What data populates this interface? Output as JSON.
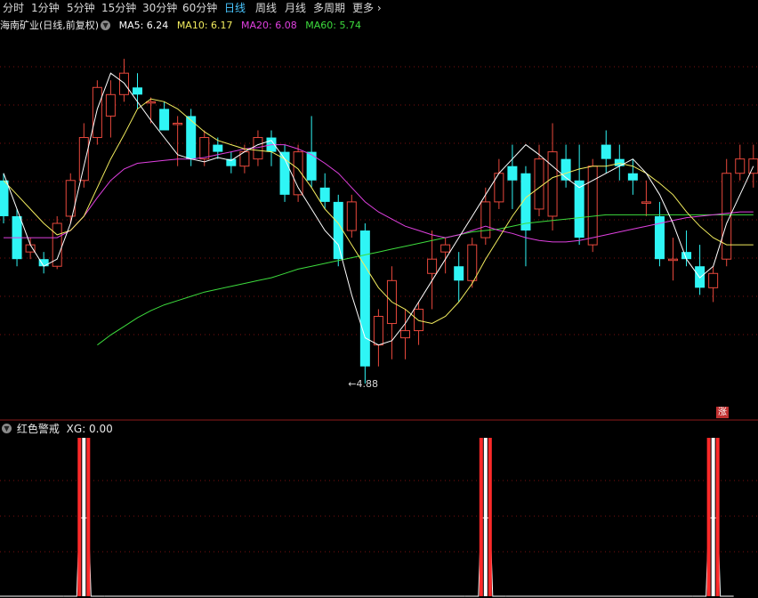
{
  "tabs": [
    {
      "label": "分时",
      "active": false
    },
    {
      "label": "1分钟",
      "active": false
    },
    {
      "label": "5分钟",
      "active": false
    },
    {
      "label": "15分钟",
      "active": false
    },
    {
      "label": "30分钟",
      "active": false
    },
    {
      "label": "60分钟",
      "active": false
    },
    {
      "label": "日线",
      "active": true
    },
    {
      "label": "周线",
      "active": false
    },
    {
      "label": "月线",
      "active": false
    },
    {
      "label": "多周期",
      "active": false
    },
    {
      "label": "更多",
      "active": false
    }
  ],
  "main_legend": {
    "title": "海南矿业(日线,前复权)",
    "ma5": "MA5: 6.24",
    "ma10": "MA10: 6.17",
    "ma20": "MA20: 6.08",
    "ma60": "MA60: 5.74"
  },
  "indicator_legend": {
    "name": "红色警戒",
    "value": "XG: 0.00"
  },
  "rise_badge": "涨",
  "colors": {
    "up": "#e8483c",
    "down": "#2ff5f5",
    "ma5": "#ffffff",
    "ma10": "#f2ec5e",
    "ma20": "#e040e0",
    "ma60": "#3ddc3d",
    "grid": "#7a1010",
    "active_tab": "#49c6ff"
  },
  "chart_data": {
    "type": "candlestick",
    "title": "海南矿业(日线,前复权)",
    "y_range": [
      4.7,
      7.3
    ],
    "annotation": {
      "label": "4.88",
      "candle_index": 26
    },
    "candles": [
      [
        6.3,
        6.35,
        6.0,
        6.05
      ],
      [
        6.05,
        6.1,
        5.7,
        5.75
      ],
      [
        5.8,
        5.9,
        5.75,
        5.85
      ],
      [
        5.75,
        5.8,
        5.65,
        5.7
      ],
      [
        5.7,
        6.05,
        5.68,
        6.0
      ],
      [
        6.05,
        6.35,
        6.0,
        6.3
      ],
      [
        6.3,
        6.7,
        6.25,
        6.6
      ],
      [
        6.6,
        7.0,
        6.55,
        6.95
      ],
      [
        6.75,
        7.0,
        6.6,
        6.9
      ],
      [
        6.9,
        7.15,
        6.85,
        7.05
      ],
      [
        6.95,
        7.05,
        6.8,
        6.9
      ],
      [
        6.85,
        6.88,
        6.7,
        6.85
      ],
      [
        6.8,
        6.85,
        6.7,
        6.65
      ],
      [
        6.7,
        6.75,
        6.4,
        6.7
      ],
      [
        6.75,
        6.8,
        6.4,
        6.45
      ],
      [
        6.45,
        6.65,
        6.4,
        6.6
      ],
      [
        6.55,
        6.6,
        6.45,
        6.5
      ],
      [
        6.45,
        6.5,
        6.35,
        6.4
      ],
      [
        6.4,
        6.55,
        6.35,
        6.5
      ],
      [
        6.45,
        6.65,
        6.4,
        6.6
      ],
      [
        6.6,
        6.65,
        6.4,
        6.5
      ],
      [
        6.5,
        6.55,
        6.15,
        6.2
      ],
      [
        6.2,
        6.55,
        6.15,
        6.5
      ],
      [
        6.5,
        6.75,
        6.25,
        6.3
      ],
      [
        6.25,
        6.35,
        6.1,
        6.15
      ],
      [
        6.15,
        6.2,
        5.7,
        5.75
      ],
      [
        5.95,
        6.2,
        5.9,
        6.15
      ],
      [
        5.95,
        6.0,
        4.88,
        5.0
      ],
      [
        5.15,
        5.4,
        5.0,
        5.35
      ],
      [
        5.3,
        5.7,
        5.05,
        5.6
      ],
      [
        5.2,
        5.4,
        5.05,
        5.25
      ],
      [
        5.25,
        5.45,
        5.15,
        5.4
      ],
      [
        5.65,
        5.95,
        5.4,
        5.75
      ],
      [
        5.8,
        5.9,
        5.65,
        5.85
      ],
      [
        5.7,
        5.8,
        5.45,
        5.6
      ],
      [
        5.6,
        5.9,
        5.55,
        5.85
      ],
      [
        5.9,
        6.25,
        5.85,
        6.15
      ],
      [
        6.15,
        6.45,
        6.1,
        6.35
      ],
      [
        6.4,
        6.55,
        6.1,
        6.3
      ],
      [
        6.35,
        6.4,
        5.7,
        5.95
      ],
      [
        6.1,
        6.55,
        6.05,
        6.45
      ],
      [
        6.05,
        6.7,
        5.95,
        6.5
      ],
      [
        6.45,
        6.55,
        6.25,
        6.3
      ],
      [
        6.3,
        6.55,
        5.85,
        5.9
      ],
      [
        5.85,
        6.45,
        5.8,
        6.4
      ],
      [
        6.55,
        6.65,
        6.35,
        6.45
      ],
      [
        6.45,
        6.55,
        6.3,
        6.4
      ],
      [
        6.35,
        6.45,
        6.2,
        6.3
      ],
      [
        6.15,
        6.3,
        6.05,
        6.15
      ],
      [
        6.05,
        6.15,
        5.7,
        5.75
      ],
      [
        5.75,
        5.9,
        5.6,
        5.75
      ],
      [
        5.8,
        5.95,
        5.7,
        5.75
      ],
      [
        5.7,
        5.85,
        5.5,
        5.55
      ],
      [
        5.55,
        5.7,
        5.45,
        5.65
      ],
      [
        5.75,
        6.45,
        5.7,
        6.35
      ],
      [
        6.35,
        6.55,
        6.3,
        6.45
      ],
      [
        6.35,
        6.55,
        6.25,
        6.45
      ]
    ],
    "ma5": [
      6.35,
      6.1,
      5.85,
      5.7,
      5.75,
      6.0,
      6.4,
      6.8,
      7.05,
      6.98,
      6.85,
      6.72,
      6.6,
      6.48,
      6.45,
      6.43,
      6.46,
      6.44,
      6.5,
      6.55,
      6.58,
      6.45,
      6.25,
      6.1,
      5.95,
      5.85,
      5.5,
      5.2,
      5.15,
      5.18,
      5.3,
      5.45,
      5.6,
      5.75,
      5.9,
      6.05,
      6.2,
      6.35,
      6.45,
      6.55,
      6.48,
      6.4,
      6.32,
      6.25,
      6.3,
      6.35,
      6.4,
      6.45,
      6.35,
      6.2,
      6.0,
      5.75,
      5.62,
      5.7,
      6.0,
      6.2,
      6.4
    ],
    "ma10": [
      6.3,
      6.2,
      6.1,
      6.0,
      5.92,
      5.95,
      6.05,
      6.25,
      6.45,
      6.62,
      6.8,
      6.87,
      6.85,
      6.8,
      6.72,
      6.64,
      6.58,
      6.55,
      6.52,
      6.51,
      6.5,
      6.45,
      6.38,
      6.25,
      6.1,
      6.0,
      5.85,
      5.7,
      5.55,
      5.45,
      5.4,
      5.32,
      5.3,
      5.35,
      5.45,
      5.58,
      5.75,
      5.9,
      6.05,
      6.18,
      6.25,
      6.32,
      6.35,
      6.38,
      6.4,
      6.4,
      6.42,
      6.4,
      6.35,
      6.28,
      6.2,
      6.08,
      5.98,
      5.9,
      5.85,
      5.85,
      5.85
    ],
    "ma20": [
      5.9,
      5.9,
      5.9,
      5.9,
      5.9,
      5.95,
      6.05,
      6.18,
      6.3,
      6.38,
      6.42,
      6.43,
      6.44,
      6.45,
      6.45,
      6.46,
      6.48,
      6.5,
      6.52,
      6.53,
      6.55,
      6.55,
      6.52,
      6.48,
      6.42,
      6.35,
      6.25,
      6.15,
      6.08,
      6.03,
      5.98,
      5.95,
      5.92,
      5.9,
      5.92,
      5.95,
      5.98,
      5.95,
      5.93,
      5.9,
      5.88,
      5.87,
      5.87,
      5.88,
      5.9,
      5.92,
      5.94,
      5.96,
      5.98,
      6.0,
      6.02,
      6.04,
      6.05,
      6.06,
      6.07,
      6.08,
      6.08
    ],
    "ma60": [
      null,
      null,
      null,
      null,
      null,
      null,
      null,
      5.15,
      5.22,
      5.28,
      5.34,
      5.39,
      5.43,
      5.46,
      5.49,
      5.52,
      5.54,
      5.56,
      5.58,
      5.6,
      5.62,
      5.65,
      5.68,
      5.7,
      5.72,
      5.74,
      5.76,
      5.78,
      5.8,
      5.82,
      5.84,
      5.86,
      5.88,
      5.9,
      5.92,
      5.94,
      5.95,
      5.96,
      5.98,
      6.0,
      6.01,
      6.02,
      6.03,
      6.04,
      6.05,
      6.06,
      6.06,
      6.06,
      6.06,
      6.06,
      6.06,
      6.06,
      6.06,
      6.06,
      6.06,
      6.06,
      6.06
    ],
    "indicator": {
      "name": "红色警戒",
      "series": "XG",
      "signals": [
        6,
        36,
        53
      ]
    }
  }
}
